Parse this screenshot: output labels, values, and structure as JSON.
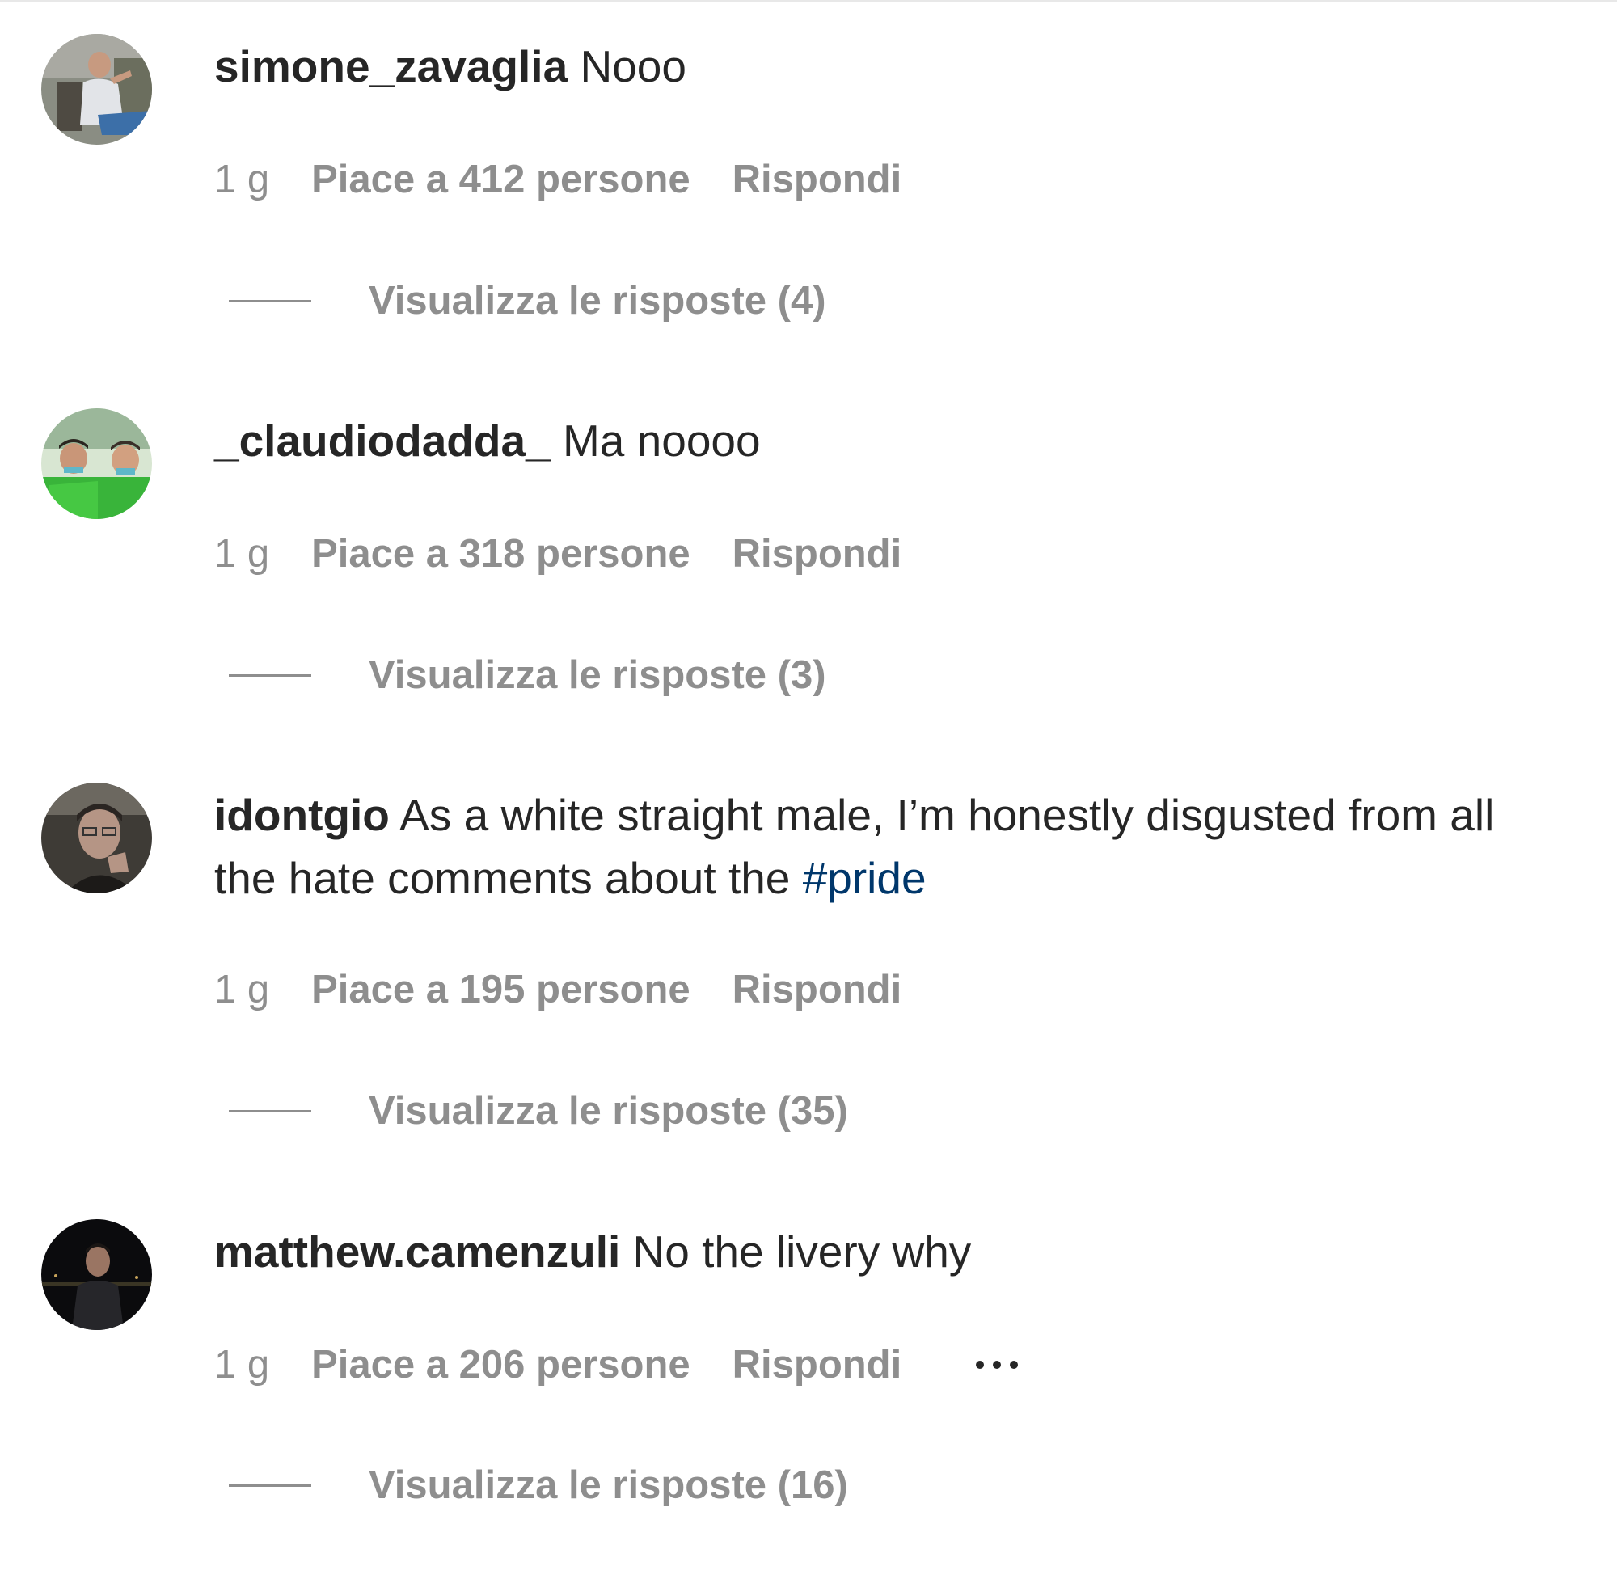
{
  "comments": [
    {
      "username": "simone_zavaglia",
      "text": "Nooo",
      "time": "1 g",
      "likes": "Piace a 412 persone",
      "reply": "Rispondi",
      "view_replies": "Visualizza le risposte (4)"
    },
    {
      "username": "_claudiodadda_",
      "text": "Ma noooo",
      "time": "1 g",
      "likes": "Piace a 318 persone",
      "reply": "Rispondi",
      "view_replies": "Visualizza le risposte (3)"
    },
    {
      "username": "idontgio",
      "text": "As a white straight male, I’m honestly disgusted from all the hate comments about the",
      "hashtag": "#pride",
      "time": "1 g",
      "likes": "Piace a 195 persone",
      "reply": "Rispondi",
      "view_replies": "Visualizza le risposte (35)"
    },
    {
      "username": "matthew.camenzuli",
      "text": "No the livery why",
      "time": "1 g",
      "likes": "Piace a 206 persone",
      "reply": "Rispondi",
      "more_icon": "more-options-icon",
      "view_replies": "Visualizza le risposte (16)"
    }
  ],
  "colors": {
    "text": "#262626",
    "secondary": "#8e8e8e",
    "hashtag": "#00376b"
  }
}
